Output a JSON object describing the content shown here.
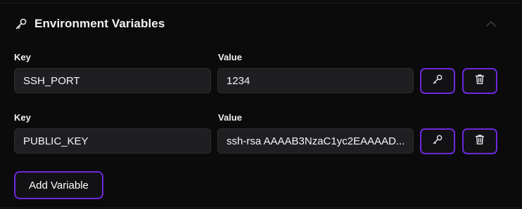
{
  "section": {
    "title": "Environment Variables",
    "icon": "key-icon",
    "collapse_icon": "chevron-up-icon"
  },
  "variables": [
    {
      "key_label": "Key",
      "value_label": "Value",
      "key": "SSH_PORT",
      "value": "1234"
    },
    {
      "key_label": "Key",
      "value_label": "Value",
      "key": "PUBLIC_KEY",
      "value": "ssh-rsa AAAAB3NzaC1yc2EAAAAD..."
    }
  ],
  "row_actions": {
    "edit_icon": "key-icon",
    "delete_icon": "trash-icon"
  },
  "add_button_label": "Add Variable",
  "colors": {
    "background": "#0b0b0c",
    "field_bg": "#1f1f22",
    "accent": "#6d28d9",
    "text": "#ffffff"
  }
}
